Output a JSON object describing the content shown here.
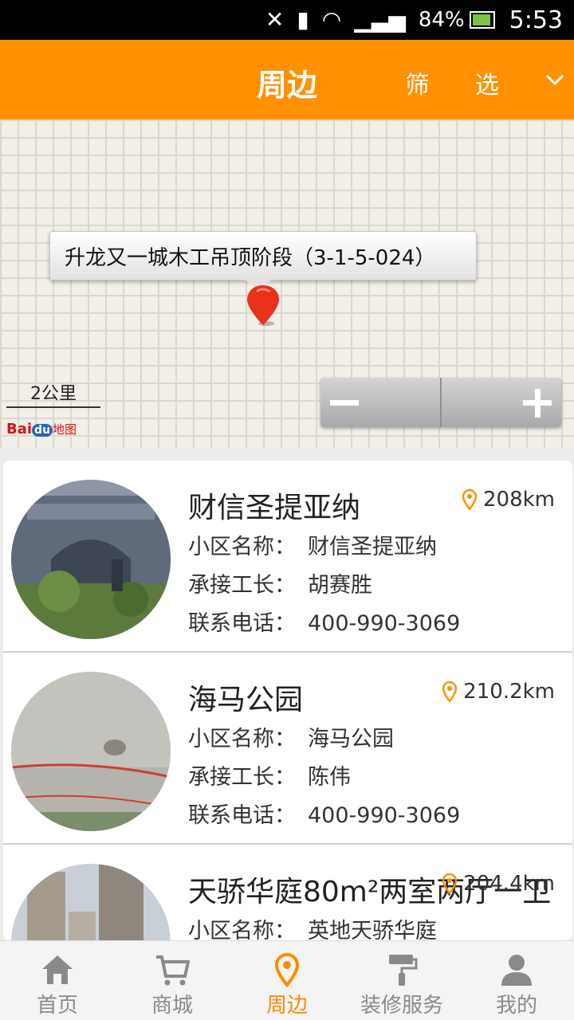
{
  "status_bar": {
    "battery": "84%",
    "time": "5:53"
  },
  "header": {
    "title": "周边",
    "filter_label": "筛 选"
  },
  "map": {
    "marker_label": "升龙又一城木工吊顶阶段（3-1-5-024）",
    "scale_label": "2公里",
    "logo": "Baidu地图"
  },
  "list": {
    "items": [
      {
        "name": "财信圣提亚纳",
        "distance": "208km",
        "community_label": "小区名称：",
        "community": "财信圣提亚纳",
        "foreman_label": "承接工长：",
        "foreman": "胡赛胜",
        "phone_label": "联系电话：",
        "phone": "400-990-3069"
      },
      {
        "name": "海马公园",
        "distance": "210.2km",
        "community_label": "小区名称：",
        "community": "海马公园",
        "foreman_label": "承接工长：",
        "foreman": "陈伟",
        "phone_label": "联系电话：",
        "phone": "400-990-3069"
      },
      {
        "name": "天骄华庭80m²两室两厅一卫",
        "distance": "204.4km",
        "community_label": "小区名称：",
        "community": "英地天骄华庭"
      }
    ]
  },
  "tabs": [
    {
      "label": "首页",
      "icon": "home-icon"
    },
    {
      "label": "商城",
      "icon": "cart-icon"
    },
    {
      "label": "周边",
      "icon": "location-pin-icon"
    },
    {
      "label": "装修服务",
      "icon": "paint-roller-icon"
    },
    {
      "label": "我的",
      "icon": "user-icon"
    }
  ],
  "colors": {
    "accent": "#ff9000",
    "active_tab": "#ff8a00",
    "inactive_tab": "#8a8a8a"
  }
}
